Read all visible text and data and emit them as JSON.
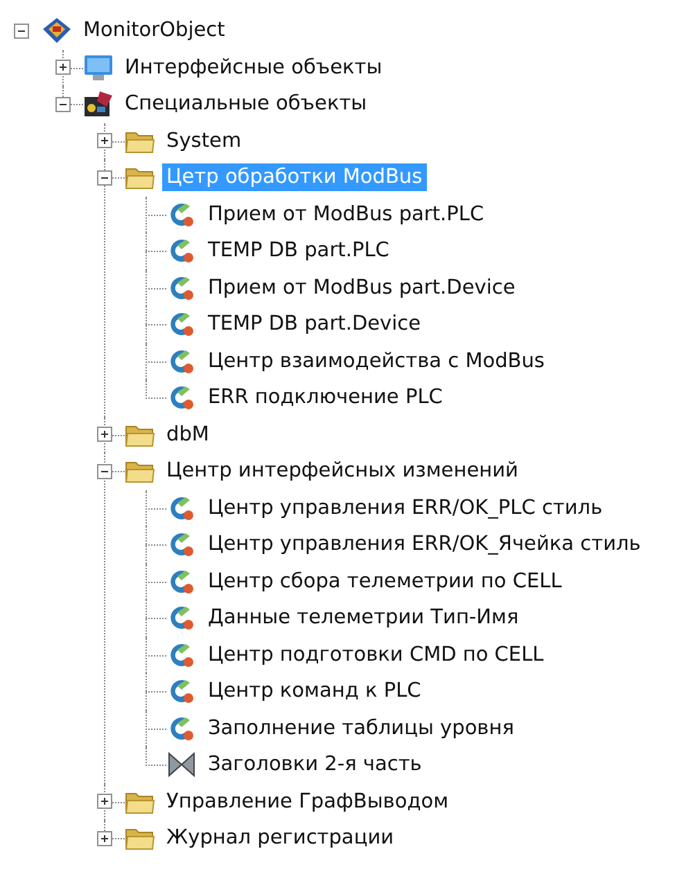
{
  "tree": [
    {
      "label": "MonitorObject",
      "kind": "root",
      "expanded": true,
      "selected": false,
      "children": [
        {
          "label": "Интерфейсные объекты",
          "kind": "monitor",
          "expanded": false,
          "selected": false
        },
        {
          "label": "Специальные объекты",
          "kind": "special",
          "expanded": true,
          "selected": false,
          "children": [
            {
              "label": "System",
              "kind": "folder",
              "expanded": false,
              "selected": false
            },
            {
              "label": "Цетр обработки ModBus",
              "kind": "folder",
              "expanded": true,
              "selected": true,
              "children": [
                {
                  "label": "Прием от ModBus part.PLC",
                  "kind": "block",
                  "selected": false
                },
                {
                  "label": "TEMP DB part.PLC",
                  "kind": "block",
                  "selected": false
                },
                {
                  "label": "Прием от ModBus part.Device",
                  "kind": "block",
                  "selected": false
                },
                {
                  "label": "TEMP DB part.Device",
                  "kind": "block",
                  "selected": false
                },
                {
                  "label": "Центр взаимодейства с ModBus",
                  "kind": "block",
                  "selected": false
                },
                {
                  "label": "ERR подключение PLC",
                  "kind": "block",
                  "selected": false
                }
              ]
            },
            {
              "label": "dbM",
              "kind": "folder",
              "expanded": false,
              "selected": false
            },
            {
              "label": "Центр интерфейсных изменений",
              "kind": "folder",
              "expanded": true,
              "selected": false,
              "children": [
                {
                  "label": "Центр управления ERR/OK_PLC стиль",
                  "kind": "block",
                  "selected": false
                },
                {
                  "label": "Центр управления ERR/OK_Ячейка стиль",
                  "kind": "block",
                  "selected": false
                },
                {
                  "label": "Центр сбора телеметрии по CELL",
                  "kind": "block",
                  "selected": false
                },
                {
                  "label": "Данные телеметрии Тип-Имя",
                  "kind": "block",
                  "selected": false
                },
                {
                  "label": "Центр подготовки CMD по CELL",
                  "kind": "block",
                  "selected": false
                },
                {
                  "label": "Центр команд к PLC",
                  "kind": "block",
                  "selected": false
                },
                {
                  "label": "Заполнение таблицы уровня",
                  "kind": "block",
                  "selected": false
                },
                {
                  "label": "Заголовки 2-я часть",
                  "kind": "valve",
                  "selected": false
                }
              ]
            },
            {
              "label": "Управление ГрафВыводом",
              "kind": "folder",
              "expanded": false,
              "selected": false
            },
            {
              "label": "Журнал регистрации",
              "kind": "folder",
              "expanded": false,
              "selected": false
            }
          ]
        }
      ]
    }
  ]
}
